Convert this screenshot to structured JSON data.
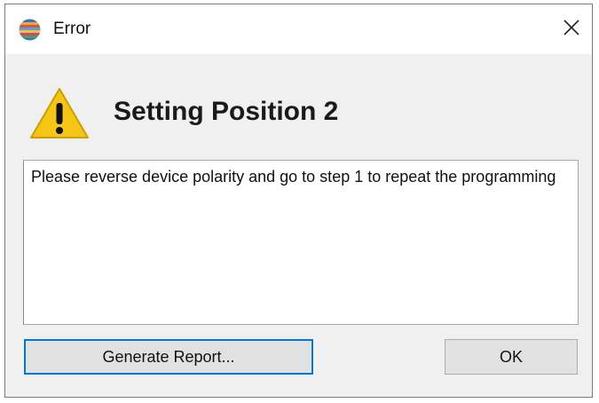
{
  "window": {
    "title": "Error",
    "app_icon": "striped-globe-icon",
    "close_icon": "close-icon"
  },
  "content": {
    "warning_icon": "warning-triangle-icon",
    "heading": "Setting Position 2",
    "message": "Please reverse device polarity and go to step 1 to repeat the programming"
  },
  "buttons": {
    "generate_report_label": "Generate Report...",
    "ok_label": "OK"
  },
  "colors": {
    "focus_border": "#0078d7",
    "warning_yellow": "#f5c518",
    "dialog_background": "#f0f0f0"
  }
}
